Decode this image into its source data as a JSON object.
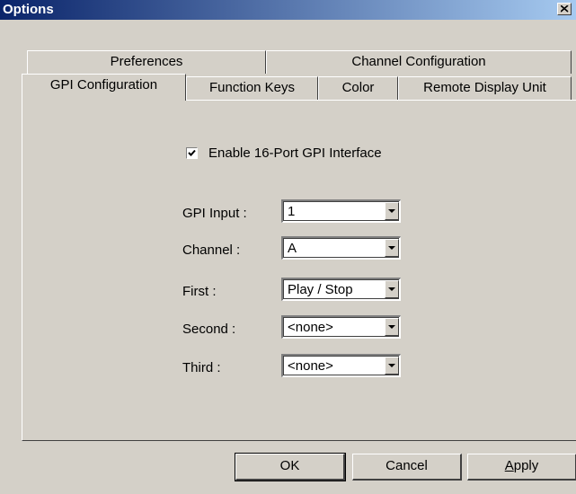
{
  "window": {
    "title": "Options",
    "close_icon": "close-icon"
  },
  "tabs": {
    "row_back": [
      {
        "label": "Preferences"
      },
      {
        "label": "Channel Configuration"
      }
    ],
    "row_front": [
      {
        "label": "GPI Configuration",
        "active": true
      },
      {
        "label": "Function Keys"
      },
      {
        "label": "Color"
      },
      {
        "label": "Remote Display Unit"
      }
    ]
  },
  "gpi": {
    "enable_label": "Enable 16-Port GPI Interface",
    "enable_checked": true,
    "fields": [
      {
        "label": "GPI Input :",
        "value": "1"
      },
      {
        "label": "Channel :",
        "value": "A"
      },
      {
        "label": "First :",
        "value": "Play / Stop"
      },
      {
        "label": "Second :",
        "value": "<none>"
      },
      {
        "label": "Third :",
        "value": "<none>"
      }
    ]
  },
  "buttons": {
    "ok": "OK",
    "cancel": "Cancel",
    "apply_prefix": "",
    "apply_underlined": "A",
    "apply_rest": "pply"
  },
  "colors": {
    "face": "#d4d0c8",
    "title_gradient_start": "#0a246a",
    "title_gradient_end": "#a6caf0"
  }
}
